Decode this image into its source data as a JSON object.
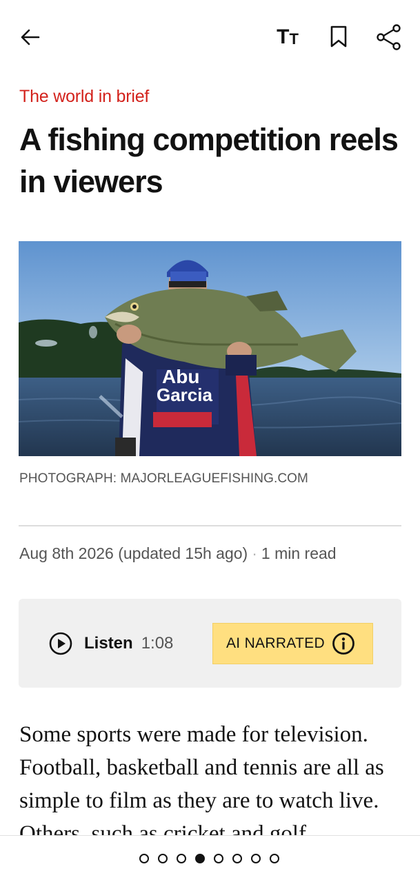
{
  "toolbar": {
    "back_icon": "arrow-left-icon",
    "text_size_big": "T",
    "text_size_small": "T",
    "bookmark_icon": "bookmark-icon",
    "share_icon": "share-icon"
  },
  "article": {
    "section": "The world in brief",
    "headline": "A fishing competition reels in viewers",
    "photo_caption": "PHOTOGRAPH: MAJORLEAGUEFISHING.COM",
    "date": "Aug 8th 2026 (updated 15h ago)",
    "read_time": "1 min read",
    "body": "Some sports were made for television. Football, basketball and tennis are all as simple to film as they are to watch live. Others, such as cricket and golf,"
  },
  "audio": {
    "listen_label": "Listen",
    "duration": "1:08",
    "ai_label": "AI NARRATED",
    "play_icon": "play-circle-icon",
    "info_icon": "info-icon"
  },
  "pagination": {
    "total": 8,
    "current": 4
  },
  "colors": {
    "section": "#d3221c",
    "ai_badge": "#ffdf80",
    "listen_bg": "#f0f0f0"
  }
}
